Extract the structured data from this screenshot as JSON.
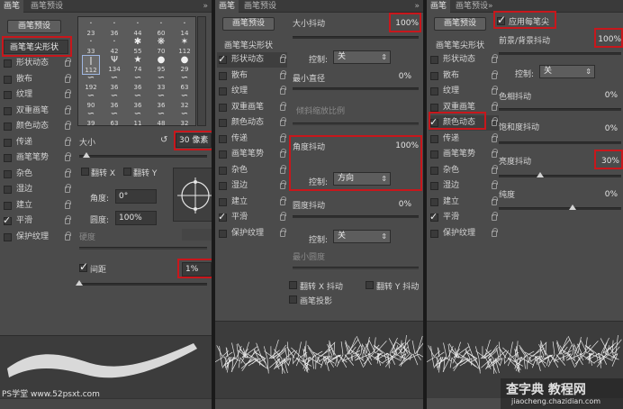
{
  "common": {
    "tab_brush": "画笔",
    "tab_presets": "画笔预设",
    "preset_button": "画笔预设",
    "brush_tip_shape": "画笔笔尖形状",
    "double_arrow": "»"
  },
  "sidebar_items": [
    {
      "label": "形状动态",
      "checked": false
    },
    {
      "label": "散布",
      "checked": false
    },
    {
      "label": "纹理",
      "checked": false
    },
    {
      "label": "双重画笔",
      "checked": false
    },
    {
      "label": "颜色动态",
      "checked": false
    },
    {
      "label": "传递",
      "checked": false
    },
    {
      "label": "画笔笔势",
      "checked": false
    },
    {
      "label": "杂色",
      "checked": false
    },
    {
      "label": "湿边",
      "checked": false
    },
    {
      "label": "建立",
      "checked": false
    },
    {
      "label": "平滑",
      "checked": true
    },
    {
      "label": "保护纹理",
      "checked": false
    }
  ],
  "panel1": {
    "brush_grid": [
      {
        "num": "23",
        "glyph": "·"
      },
      {
        "num": "36",
        "glyph": "·"
      },
      {
        "num": "44",
        "glyph": "·"
      },
      {
        "num": "60",
        "glyph": "·"
      },
      {
        "num": "14",
        "glyph": "·"
      },
      {
        "num": "33",
        "glyph": "·"
      },
      {
        "num": "42",
        "glyph": "·"
      },
      {
        "num": "55",
        "glyph": "✱"
      },
      {
        "num": "70",
        "glyph": "❋"
      },
      {
        "num": "112",
        "glyph": "✶"
      },
      {
        "num": "112",
        "glyph": "ǀ"
      },
      {
        "num": "134",
        "glyph": "Ψ"
      },
      {
        "num": "74",
        "glyph": "★"
      },
      {
        "num": "95",
        "glyph": "●"
      },
      {
        "num": "29",
        "glyph": "●"
      },
      {
        "num": "192",
        "glyph": "∽"
      },
      {
        "num": "36",
        "glyph": "∽"
      },
      {
        "num": "36",
        "glyph": "∽"
      },
      {
        "num": "33",
        "glyph": "∽"
      },
      {
        "num": "63",
        "glyph": "∽"
      },
      {
        "num": "90",
        "glyph": "∽"
      },
      {
        "num": "36",
        "glyph": "∽"
      },
      {
        "num": "36",
        "glyph": "∽"
      },
      {
        "num": "36",
        "glyph": "∽"
      },
      {
        "num": "32",
        "glyph": "∽"
      },
      {
        "num": "39",
        "glyph": "∽"
      },
      {
        "num": "63",
        "glyph": "∽"
      },
      {
        "num": "11",
        "glyph": "∽"
      },
      {
        "num": "48",
        "glyph": "∽"
      },
      {
        "num": "32",
        "glyph": "∽"
      }
    ],
    "size_label": "大小",
    "size_value": "30 像素",
    "flip_x": "翻转 X",
    "flip_y": "翻转 Y",
    "angle_label": "角度:",
    "angle_value": "0°",
    "roundness_label": "圆度:",
    "roundness_value": "100%",
    "hardness_label": "硬度",
    "spacing_label": "间距",
    "spacing_value": "1%"
  },
  "panel2": {
    "size_jitter_label": "大小抖动",
    "size_jitter_value": "100%",
    "control_label": "控制:",
    "control_off": "关",
    "min_diameter_label": "最小直径",
    "min_diameter_value": "0%",
    "tilt_scale_label": "倾斜缩放比例",
    "angle_jitter_label": "角度抖动",
    "angle_jitter_value": "100%",
    "control_direction": "方向",
    "roundness_jitter_label": "圆度抖动",
    "roundness_jitter_value": "0%",
    "min_roundness_label": "最小圆度",
    "flip_x_jitter": "翻转 X 抖动",
    "flip_y_jitter": "翻转 Y 抖动",
    "brush_projection": "画笔投影"
  },
  "panel3": {
    "apply_per_tip": "应用每笔尖",
    "fg_bg_jitter_label": "前景/背景抖动",
    "fg_bg_jitter_value": "100%",
    "control_label": "控制:",
    "control_off": "关",
    "hue_jitter_label": "色相抖动",
    "hue_jitter_value": "0%",
    "saturation_jitter_label": "饱和度抖动",
    "saturation_jitter_value": "0%",
    "brightness_jitter_label": "亮度抖动",
    "brightness_jitter_value": "30%",
    "purity_label": "纯度",
    "purity_value": "0%"
  },
  "watermarks": {
    "left": "PS学堂 www.52psxt.com",
    "right_top": "查字典 教程网",
    "right_bottom": "jiaocheng.chazidian.com"
  },
  "colors": {
    "highlight_red": "#c8171c",
    "panel_bg": "#4b4b4b"
  }
}
